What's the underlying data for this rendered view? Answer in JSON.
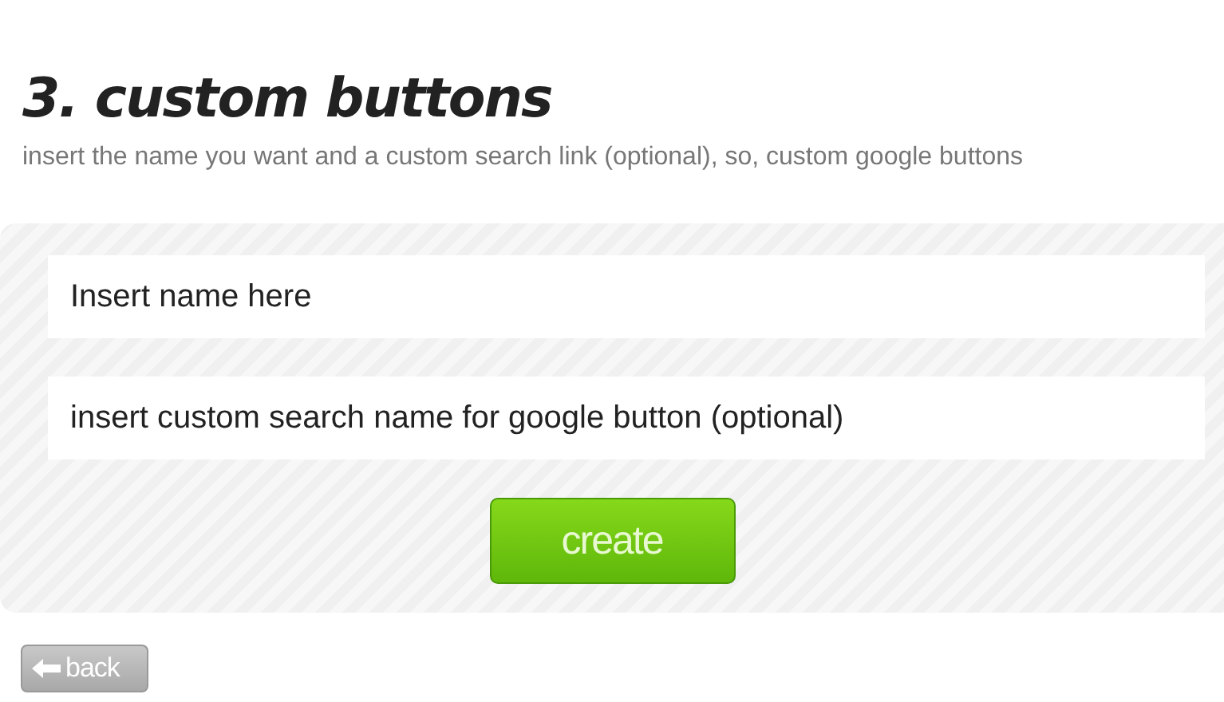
{
  "heading": "3. custom buttons",
  "subtitle": "insert the name you want and a custom search link (optional), so, custom google buttons",
  "fields": [
    {
      "placeholder": "Insert name here"
    },
    {
      "placeholder": "insert custom search name for google button (optional)"
    }
  ],
  "create_button": "create",
  "back_button": "back"
}
